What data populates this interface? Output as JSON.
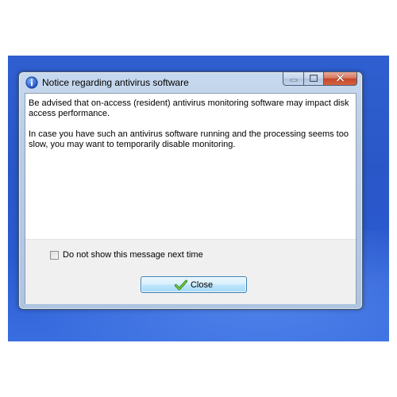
{
  "window": {
    "title": "Notice regarding antivirus software",
    "title_icon": "info-icon"
  },
  "caption_buttons": {
    "minimize": "minimize-icon",
    "maximize": "maximize-icon",
    "close": "close-icon"
  },
  "message": {
    "paragraph1": "Be advised that on-access (resident) antivirus monitoring software may impact disk access performance.",
    "paragraph2": "In case you have such an antivirus software running and the processing seems too slow, you may want to temporarily disable monitoring."
  },
  "footer": {
    "checkbox_label": "Do not show this message next time",
    "checkbox_checked": false,
    "close_label": "Close",
    "close_icon": "checkmark-icon"
  },
  "colors": {
    "desktop": "#2a57c8",
    "close_caption": "#c7472a",
    "button_border": "#3c7fb1"
  }
}
